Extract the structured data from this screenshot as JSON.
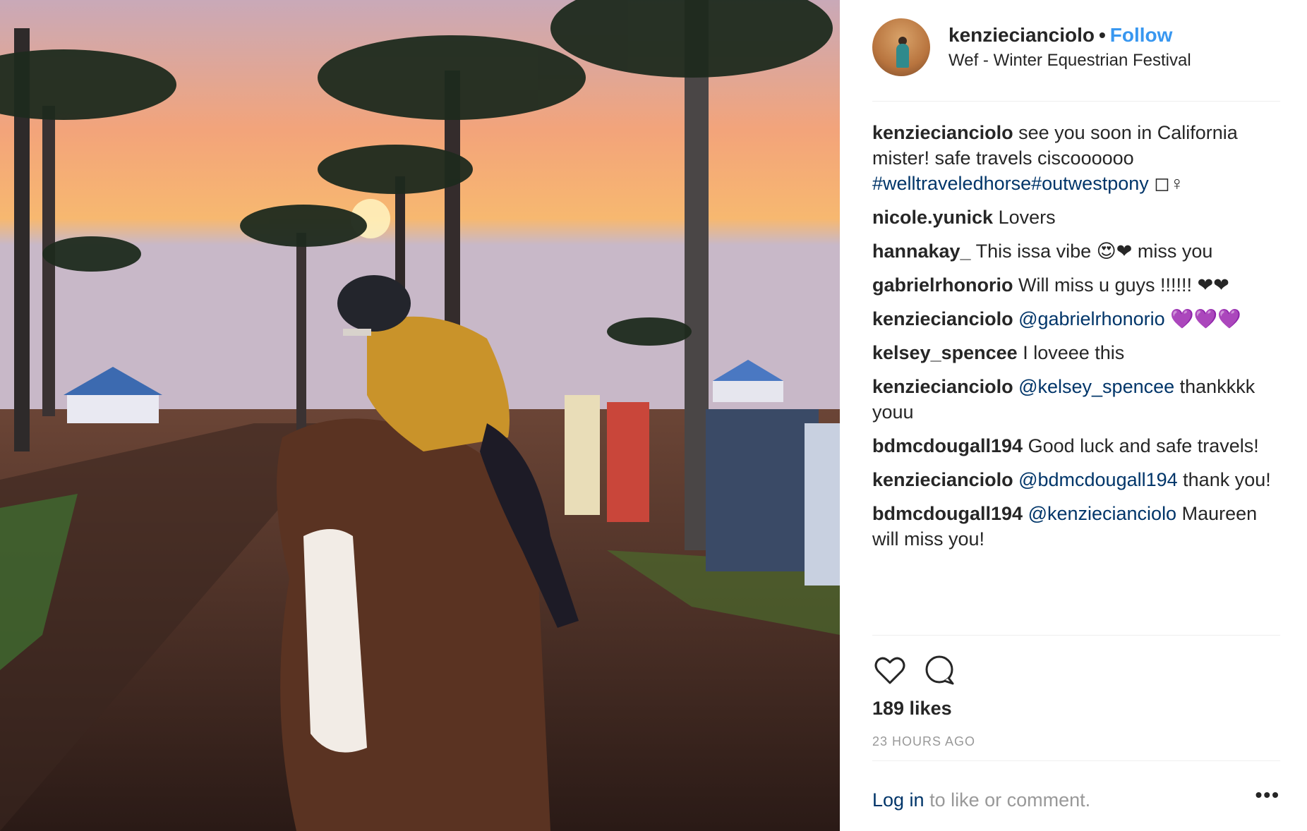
{
  "post": {
    "username": "kenziecianciolo",
    "separator": "•",
    "follow_label": "Follow",
    "location": "Wef - Winter Equestrian Festival"
  },
  "comments": [
    {
      "author": "kenziecianciolo",
      "text": "see you soon in California mister! safe travels ciscoooooo ",
      "mention": "#welltraveledhorse#outwestpony",
      "trailing": " ◻♀"
    },
    {
      "author": "nicole.yunick",
      "text": "Lovers",
      "mention": "",
      "trailing": ""
    },
    {
      "author": "hannakay_",
      "text": "This issa vibe 😍❤ miss you",
      "mention": "",
      "trailing": ""
    },
    {
      "author": "gabrielrhonorio",
      "text": "Will miss u guys !!!!!! ❤❤",
      "mention": "",
      "trailing": ""
    },
    {
      "author": "kenziecianciolo",
      "text": "",
      "mention": "@gabrielrhonorio",
      "trailing": " 💜💜💜"
    },
    {
      "author": "kelsey_spencee",
      "text": "I loveee this",
      "mention": "",
      "trailing": ""
    },
    {
      "author": "kenziecianciolo",
      "text": "",
      "mention": "@kelsey_spencee",
      "trailing": " thankkkk youu"
    },
    {
      "author": "bdmcdougall194",
      "text": "Good luck and safe travels!",
      "mention": "",
      "trailing": ""
    },
    {
      "author": "kenziecianciolo",
      "text": "",
      "mention": "@bdmcdougall194",
      "trailing": " thank you!"
    },
    {
      "author": "bdmcdougall194",
      "text": "",
      "mention": "@kenziecianciolo",
      "trailing": " Maureen will miss you!"
    }
  ],
  "actions": {
    "like_icon": "heart-outline-icon",
    "comment_icon": "speech-bubble-icon",
    "likes_label": "189 likes",
    "timestamp": "23 HOURS AGO"
  },
  "footer": {
    "login_link": "Log in",
    "login_suffix": " to like or comment.",
    "more_label": "•••"
  },
  "colors": {
    "link_blue": "#3897f0",
    "mention_blue": "#003569",
    "muted": "#999999",
    "text": "#262626"
  }
}
